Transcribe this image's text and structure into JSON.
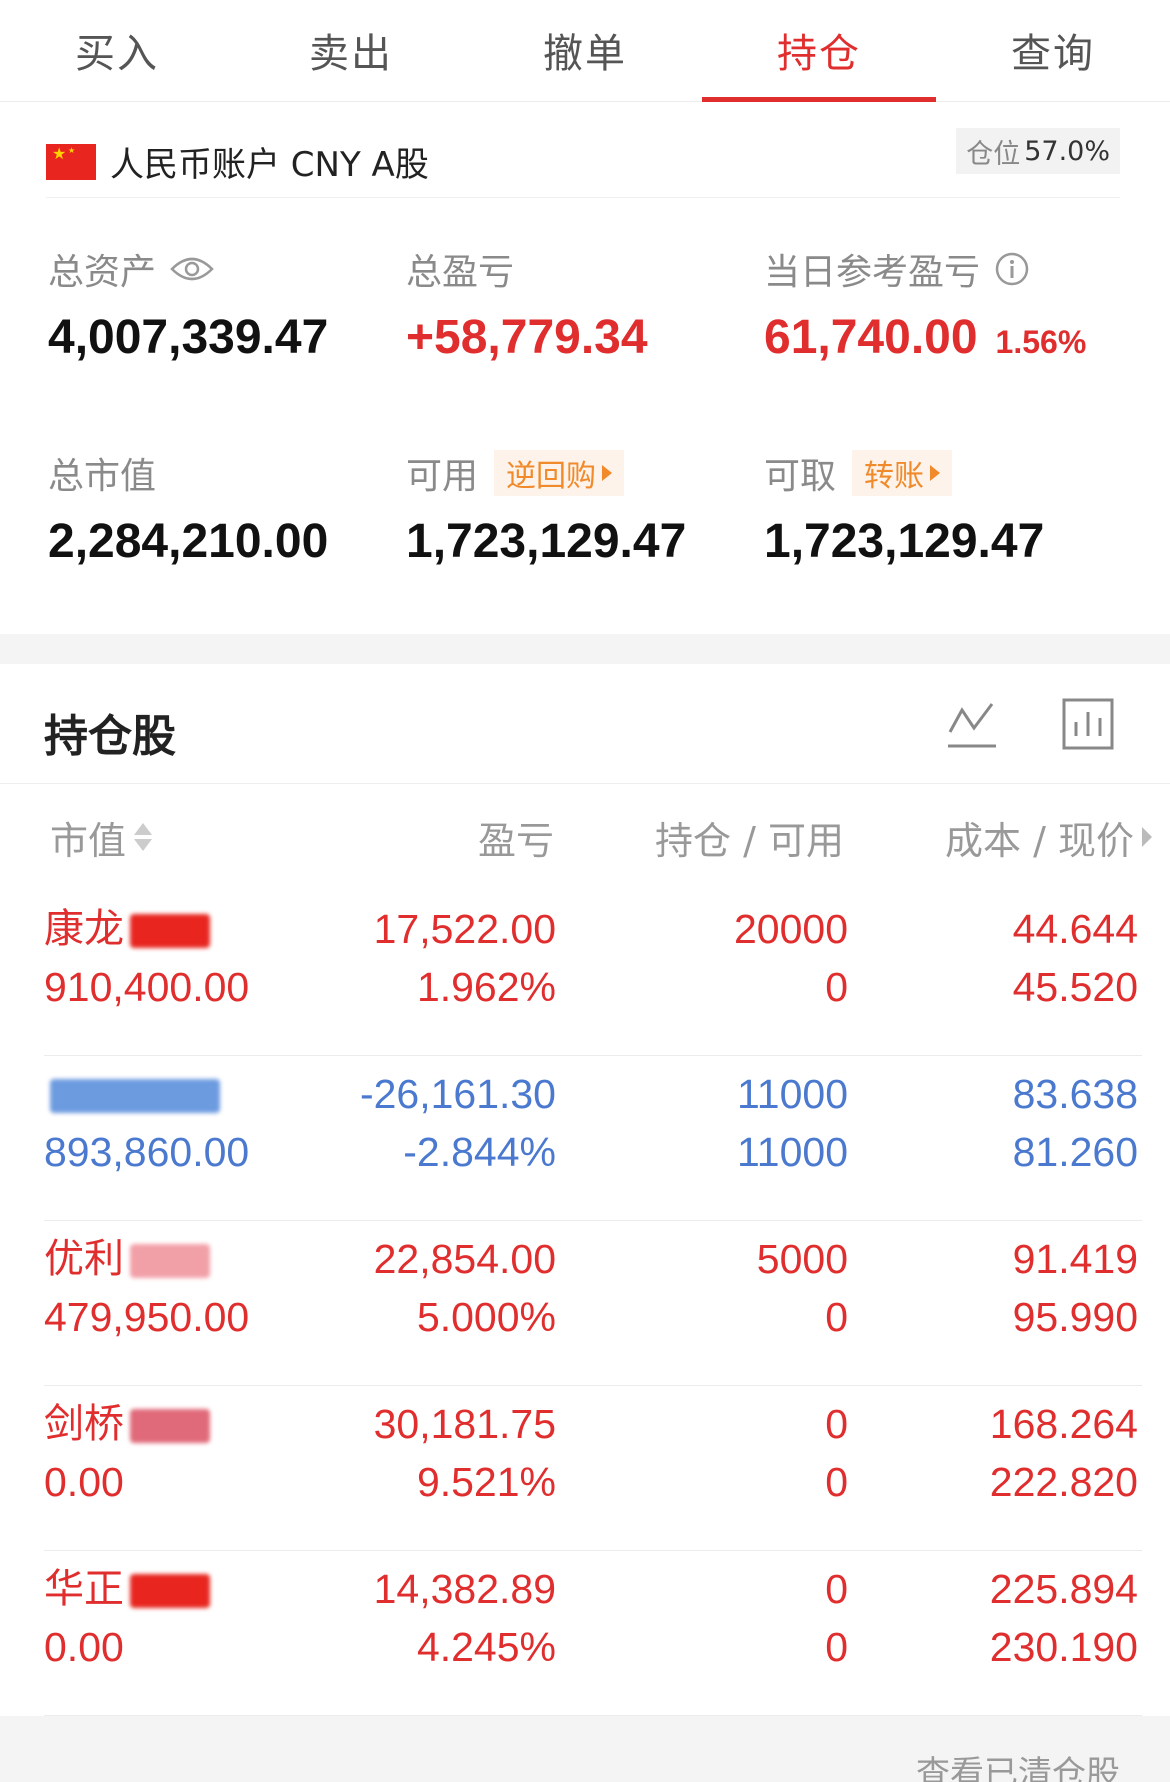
{
  "tabs": [
    "买入",
    "卖出",
    "撤单",
    "持仓",
    "查询"
  ],
  "active_tab": "持仓",
  "account": {
    "name": "人民币账户 CNY A股",
    "position_label": "仓位",
    "position_value": "57.0%"
  },
  "stats": {
    "total_assets": {
      "label": "总资产",
      "value": "4,007,339.47"
    },
    "total_pnl": {
      "label": "总盈亏",
      "value": "+58,779.34"
    },
    "daily_pnl": {
      "label": "当日参考盈亏",
      "value": "61,740.00",
      "pct": "1.56%"
    },
    "market_value": {
      "label": "总市值",
      "value": "2,284,210.00"
    },
    "available": {
      "label": "可用",
      "tag": "逆回购",
      "value": "1,723,129.47"
    },
    "withdrawable": {
      "label": "可取",
      "tag": "转账",
      "value": "1,723,129.47"
    }
  },
  "holdings": {
    "title": "持仓股",
    "columns": {
      "market_value": "市值",
      "pnl": "盈亏",
      "position": "持仓 / 可用",
      "cost_price": "成本 / 现价"
    },
    "rows": [
      {
        "name": "康龙",
        "market_value": "910,400.00",
        "pnl": "17,522.00",
        "pnl_pct": "1.962%",
        "position": "20000",
        "available": "0",
        "cost": "44.644",
        "price": "45.520",
        "color": "red"
      },
      {
        "name": "",
        "market_value": "893,860.00",
        "pnl": "-26,161.30",
        "pnl_pct": "-2.844%",
        "position": "11000",
        "available": "11000",
        "cost": "83.638",
        "price": "81.260",
        "color": "blue"
      },
      {
        "name": "优利",
        "market_value": "479,950.00",
        "pnl": "22,854.00",
        "pnl_pct": "5.000%",
        "position": "5000",
        "available": "0",
        "cost": "91.419",
        "price": "95.990",
        "color": "red"
      },
      {
        "name": "剑桥",
        "market_value": "0.00",
        "pnl": "30,181.75",
        "pnl_pct": "9.521%",
        "position": "0",
        "available": "0",
        "cost": "168.264",
        "price": "222.820",
        "color": "red"
      },
      {
        "name": "华正",
        "market_value": "0.00",
        "pnl": "14,382.89",
        "pnl_pct": "4.245%",
        "position": "0",
        "available": "0",
        "cost": "225.894",
        "price": "230.190",
        "color": "red"
      }
    ]
  },
  "footer": {
    "link": "查看已清仓股"
  },
  "colors": {
    "accent": "#e02e2e",
    "loss": "#4a79cf",
    "tag": "#f08a2a"
  }
}
